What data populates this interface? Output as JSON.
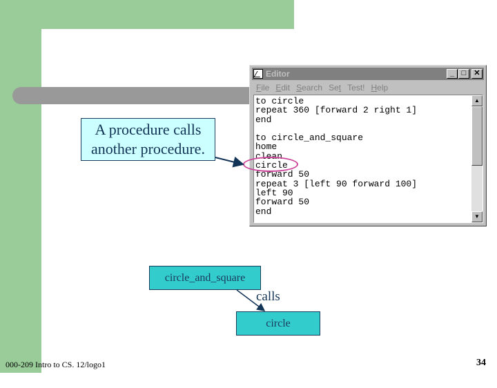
{
  "editor": {
    "title": "Editor",
    "window_buttons": {
      "minimize": "_",
      "maximize": "□",
      "close": "✕"
    },
    "menu": [
      {
        "accel": "F",
        "rest": "ile"
      },
      {
        "accel": "E",
        "rest": "dit"
      },
      {
        "accel": "S",
        "rest": "earch"
      },
      {
        "accel": "Se",
        "rest": "t",
        "accel_last": true
      },
      {
        "accel": "",
        "rest": "Test!"
      },
      {
        "accel": "H",
        "rest": "elp"
      }
    ],
    "code": "to circle\nrepeat 360 [forward 2 right 1]\nend\n\nto circle_and_square\nhome\nclean\ncircle\nforward 50\nrepeat 3 [left 90 forward 100]\nleft 90\nforward 50\nend",
    "scroll_up": "▲",
    "scroll_down": "▼"
  },
  "callout": {
    "line1": "A procedure calls",
    "line2": "another procedure."
  },
  "diagram": {
    "caller": "circle_and_square",
    "callee": "circle",
    "relation": "calls"
  },
  "footer": {
    "course": "000-209 Intro to CS. 12/logo1",
    "page": "34"
  },
  "colors": {
    "green": "#99cc99",
    "teal": "#33cccc",
    "callout_bg": "#ccffff",
    "highlight": "#cc4499",
    "navy": "#1a3a5c"
  }
}
